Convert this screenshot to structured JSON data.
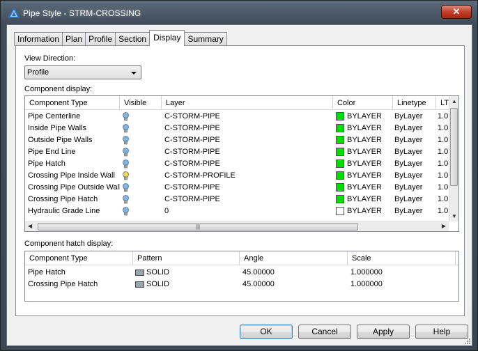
{
  "window": {
    "title": "Pipe Style - STRM-CROSSING",
    "close_label": "✕"
  },
  "tabs": [
    "Information",
    "Plan",
    "Profile",
    "Section",
    "Display",
    "Summary"
  ],
  "active_tab": "Display",
  "view_direction": {
    "label": "View Direction:",
    "value": "Profile"
  },
  "component_display": {
    "label": "Component display:",
    "columns": [
      "Component Type",
      "Visible",
      "Layer",
      "Color",
      "Linetype",
      "LT"
    ],
    "rows": [
      {
        "type": "Pipe Centerline",
        "visible": true,
        "layer": "C-STORM-PIPE",
        "color": "BYLAYER",
        "swatch": "#00dd00",
        "linetype": "ByLayer",
        "lt": "1.0"
      },
      {
        "type": "Inside Pipe Walls",
        "visible": true,
        "layer": "C-STORM-PIPE",
        "color": "BYLAYER",
        "swatch": "#00dd00",
        "linetype": "ByLayer",
        "lt": "1.0"
      },
      {
        "type": "Outside Pipe Walls",
        "visible": true,
        "layer": "C-STORM-PIPE",
        "color": "BYLAYER",
        "swatch": "#00dd00",
        "linetype": "ByLayer",
        "lt": "1.0"
      },
      {
        "type": "Pipe End Line",
        "visible": true,
        "layer": "C-STORM-PIPE",
        "color": "BYLAYER",
        "swatch": "#00dd00",
        "linetype": "ByLayer",
        "lt": "1.0"
      },
      {
        "type": "Pipe Hatch",
        "visible": true,
        "layer": "C-STORM-PIPE",
        "color": "BYLAYER",
        "swatch": "#00dd00",
        "linetype": "ByLayer",
        "lt": "1.0"
      },
      {
        "type": "Crossing Pipe Inside Wall",
        "visible": true,
        "bulb_color": "#f2d84a",
        "layer": "C-STORM-PROFILE",
        "color": "BYLAYER",
        "swatch": "#00dd00",
        "linetype": "ByLayer",
        "lt": "1.0"
      },
      {
        "type": "Crossing Pipe Outside Wall",
        "visible": true,
        "layer": "C-STORM-PIPE",
        "color": "BYLAYER",
        "swatch": "#00dd00",
        "linetype": "ByLayer",
        "lt": "1.0"
      },
      {
        "type": "Crossing Pipe Hatch",
        "visible": true,
        "layer": "C-STORM-PIPE",
        "color": "BYLAYER",
        "swatch": "#00dd00",
        "linetype": "ByLayer",
        "lt": "1.0"
      },
      {
        "type": "Hydraulic Grade Line",
        "visible": true,
        "layer": "0",
        "color": "BYLAYER",
        "swatch": "#ffffff",
        "linetype": "ByLayer",
        "lt": "1.0"
      }
    ]
  },
  "hatch_display": {
    "label": "Component hatch display:",
    "columns": [
      "Component Type",
      "Pattern",
      "Angle",
      "Scale"
    ],
    "rows": [
      {
        "type": "Pipe Hatch",
        "pattern": "SOLID",
        "angle": "45.00000",
        "scale": "1.000000"
      },
      {
        "type": "Crossing Pipe Hatch",
        "pattern": "SOLID",
        "angle": "45.00000",
        "scale": "1.000000"
      }
    ]
  },
  "buttons": {
    "ok": "OK",
    "cancel": "Cancel",
    "apply": "Apply",
    "help": "Help"
  },
  "colors": {
    "bulb_default": "#7fb6e6",
    "bulb_highlight": "#f2d84a",
    "green_swatch": "#00dd00"
  }
}
